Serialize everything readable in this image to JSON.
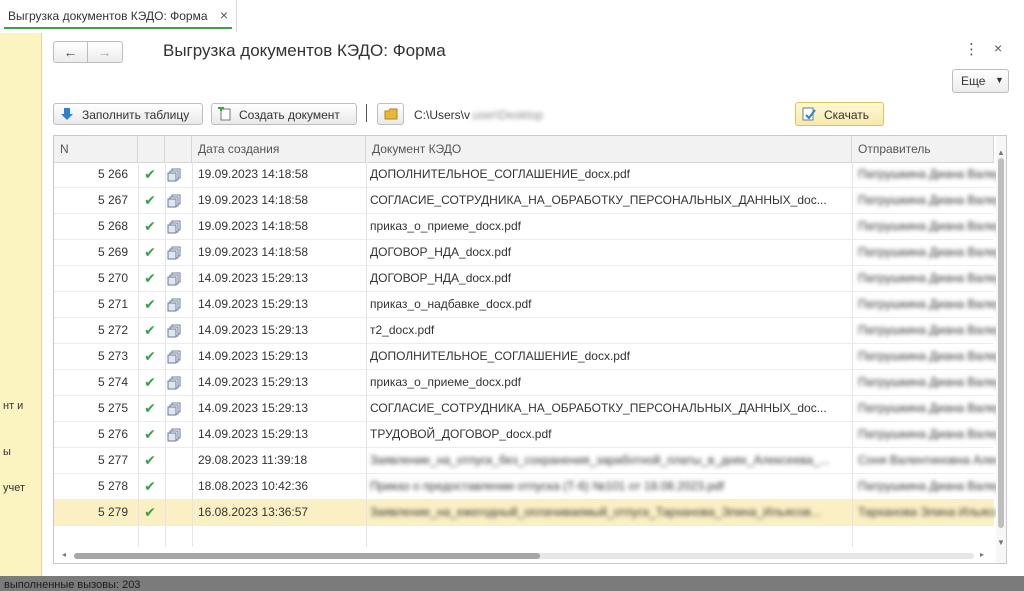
{
  "tab": {
    "title": "Выгрузка документов КЭДО: Форма",
    "close": "×"
  },
  "left_panel": {
    "line1": "нт и",
    "line2": "ы",
    "line3": "учет"
  },
  "form": {
    "title": "Выгрузка документов КЭДО: Форма",
    "nav_back": "←",
    "nav_forward": "→",
    "more_menu": "⋮",
    "close": "×",
    "more_button": "Еще",
    "fill_table_button": "Заполнить таблицу",
    "create_doc_button": "Создать документ",
    "path_prefix": "C:\\Users\\v",
    "path_rest": ".user\\Desktop",
    "download_button": "Скачать"
  },
  "grid": {
    "columns": {
      "n": "N",
      "date": "Дата создания",
      "doc": "Документ КЭДО",
      "sender": "Отправитель"
    },
    "rows": [
      {
        "n": "5 266",
        "check": "✔",
        "has_docs": true,
        "date": "19.09.2023 14:18:58",
        "doc": "ДОПОЛНИТЕЛЬНОЕ_СОГЛАШЕНИЕ_docx.pdf",
        "doc_blurred": false,
        "sender": "Патрушкина Диана Валерьевна",
        "selected": false
      },
      {
        "n": "5 267",
        "check": "✔",
        "has_docs": true,
        "date": "19.09.2023 14:18:58",
        "doc": "СОГЛАСИЕ_СОТРУДНИКА_НА_ОБРАБОТКУ_ПЕРСОНАЛЬНЫХ_ДАННЫХ_doc...",
        "doc_blurred": false,
        "sender": "Патрушкина Диана Валерьевна",
        "selected": false
      },
      {
        "n": "5 268",
        "check": "✔",
        "has_docs": true,
        "date": "19.09.2023 14:18:58",
        "doc": "приказ_о_приеме_docx.pdf",
        "doc_blurred": false,
        "sender": "Патрушкина Диана Валерьевна",
        "selected": false
      },
      {
        "n": "5 269",
        "check": "✔",
        "has_docs": true,
        "date": "19.09.2023 14:18:58",
        "doc": "ДОГОВОР_НДА_docx.pdf",
        "doc_blurred": false,
        "sender": "Патрушкина Диана Валерьевна",
        "selected": false
      },
      {
        "n": "5 270",
        "check": "✔",
        "has_docs": true,
        "date": "14.09.2023 15:29:13",
        "doc": "ДОГОВОР_НДА_docx.pdf",
        "doc_blurred": false,
        "sender": "Патрушкина Диана Валерьевна",
        "selected": false
      },
      {
        "n": "5 271",
        "check": "✔",
        "has_docs": true,
        "date": "14.09.2023 15:29:13",
        "doc": "приказ_о_надбавке_docx.pdf",
        "doc_blurred": false,
        "sender": "Патрушкина Диана Валерьевна",
        "selected": false
      },
      {
        "n": "5 272",
        "check": "✔",
        "has_docs": true,
        "date": "14.09.2023 15:29:13",
        "doc": "т2_docx.pdf",
        "doc_blurred": false,
        "sender": "Патрушкина Диана Валерьевна",
        "selected": false
      },
      {
        "n": "5 273",
        "check": "✔",
        "has_docs": true,
        "date": "14.09.2023 15:29:13",
        "doc": "ДОПОЛНИТЕЛЬНОЕ_СОГЛАШЕНИЕ_docx.pdf",
        "doc_blurred": false,
        "sender": "Патрушкина Диана Валерьевна",
        "selected": false
      },
      {
        "n": "5 274",
        "check": "✔",
        "has_docs": true,
        "date": "14.09.2023 15:29:13",
        "doc": "приказ_о_приеме_docx.pdf",
        "doc_blurred": false,
        "sender": "Патрушкина Диана Валерьевна",
        "selected": false
      },
      {
        "n": "5 275",
        "check": "✔",
        "has_docs": true,
        "date": "14.09.2023 15:29:13",
        "doc": "СОГЛАСИЕ_СОТРУДНИКА_НА_ОБРАБОТКУ_ПЕРСОНАЛЬНЫХ_ДАННЫХ_doc...",
        "doc_blurred": false,
        "sender": "Патрушкина Диана Валерьевна",
        "selected": false
      },
      {
        "n": "5 276",
        "check": "✔",
        "has_docs": true,
        "date": "14.09.2023 15:29:13",
        "doc": "ТРУДОВОЙ_ДОГОВОР_docx.pdf",
        "doc_blurred": false,
        "sender": "Патрушкина Диана Валерьевна",
        "selected": false
      },
      {
        "n": "5 277",
        "check": "✔",
        "has_docs": false,
        "date": "29.08.2023 11:39:18",
        "doc": "Заявление_на_отпуск_без_сохранения_заработной_платы_в_днях_Алексеева_...",
        "doc_blurred": true,
        "sender": "Соня Валентиновна Алексеева",
        "selected": false
      },
      {
        "n": "5 278",
        "check": "✔",
        "has_docs": false,
        "date": "18.08.2023 10:42:36",
        "doc": "Приказ о предоставлении отпуска (Т-6) №101 от 18.08.2023.pdf",
        "doc_blurred": true,
        "sender": "Патрушкина Диана Валерьевна",
        "selected": false
      },
      {
        "n": "5 279",
        "check": "✔",
        "has_docs": false,
        "date": "16.08.2023 13:36:57",
        "doc": "Заявление_на_ежегодный_оплачиваемый_отпуск_Тарханова_Элина_Ильясов...",
        "doc_blurred": true,
        "sender": "Тарханова Элина Ильясовна",
        "selected": true
      }
    ]
  },
  "status_bar": {
    "text": "выполненные вызовы: 203"
  },
  "colors": {
    "accent_green": "#3aa24b",
    "left_panel_bg": "#fbf4c0",
    "selected_row_bg": "#fbf0c4",
    "download_btn_bg": "#f7e9a9"
  }
}
